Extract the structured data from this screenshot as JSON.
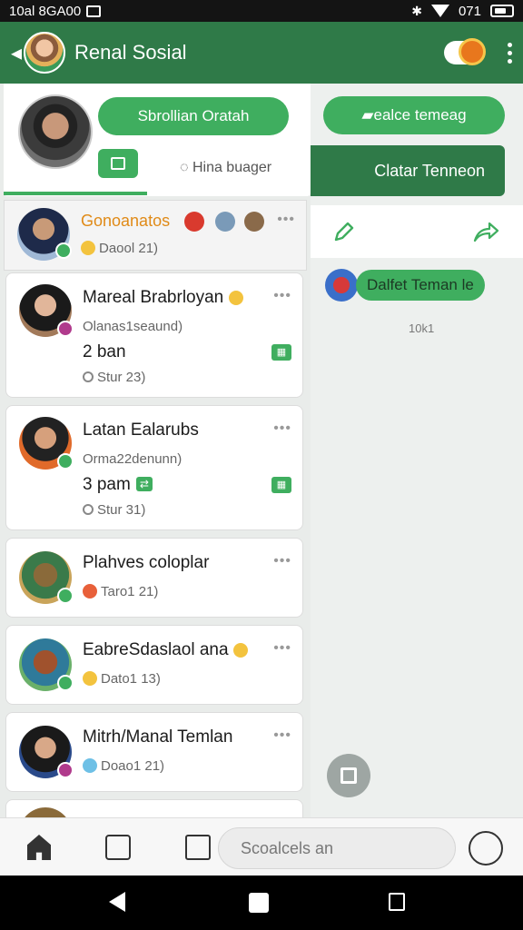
{
  "status_bar": {
    "left_text": "10al 8GA00",
    "time": "071"
  },
  "app_bar": {
    "title": "Renal Sosial"
  },
  "profile": {
    "primary_button": "Sbrollian Oratah",
    "link_text": "Hina buager"
  },
  "contacts": [
    {
      "name": "Gonoanatos",
      "sub": "Daool 21)",
      "online": true
    },
    {
      "name": "Mareal Brabrloyan",
      "sub": "Olanas1seaund)",
      "count": "2 ban",
      "meta": "Stur 23)",
      "online": true
    },
    {
      "name": "Latan Ealarubs",
      "sub": "Orma22denunn)",
      "count": "3 pam",
      "meta": "Stur 31)",
      "online": true
    },
    {
      "name": "Plahves coloplar",
      "sub": "Taro1 21)",
      "online": true
    },
    {
      "name": "EabreSdaslaol ana",
      "sub": "Dato1 13)",
      "online": true
    },
    {
      "name": "Mitrh/Manal Temlan",
      "sub": "Doao1 21)",
      "online": true
    }
  ],
  "right_panel": {
    "button_top": "ealce temeag",
    "button_main": "Clatar Tenneon",
    "chat_label": "Dalfet Teman le",
    "count_text": "10k1"
  },
  "bottom_bar": {
    "search_placeholder": "Scoalcels an"
  }
}
